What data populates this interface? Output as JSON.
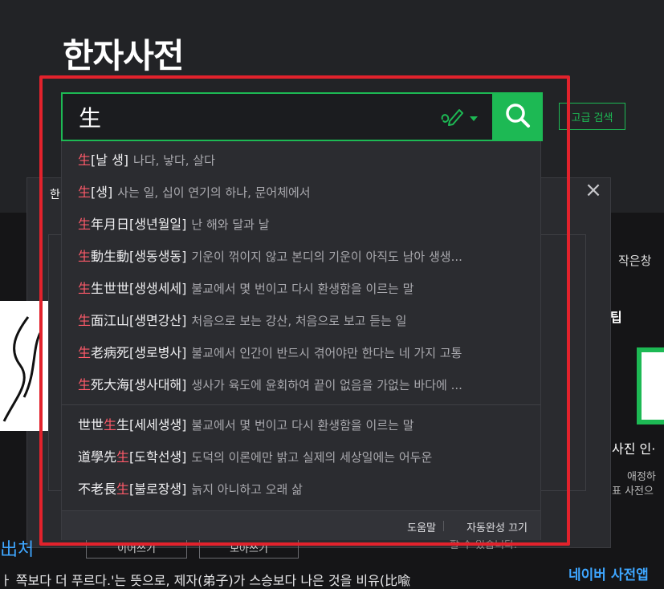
{
  "page": {
    "title": "한자사전"
  },
  "search": {
    "query": "生",
    "button_icon": "search-icon",
    "handwriting_icon": "handwriting-pen-icon",
    "advanced_label": "고급 검색"
  },
  "suggestions": {
    "group1": [
      {
        "pre": "",
        "hl": "生",
        "post": "",
        "reading": "[날 생]",
        "meaning": "나다, 낳다, 살다"
      },
      {
        "pre": "",
        "hl": "生",
        "post": "",
        "reading": "[생]",
        "meaning": "사는 일, 십이 연기의 하나, 문어체에서"
      },
      {
        "pre": "",
        "hl": "生",
        "post": "年月日",
        "reading": "[생년월일]",
        "meaning": "난 해와 달과 날"
      },
      {
        "pre": "",
        "hl": "生",
        "post": "動生動",
        "reading": "[생동생동]",
        "meaning": "기운이 꺾이지 않고 본디의 기운이 아직도 남아 생생..."
      },
      {
        "pre": "",
        "hl": "生",
        "post": "生世世",
        "reading": "[생생세세]",
        "meaning": "불교에서 몇 번이고 다시 환생함을 이르는 말"
      },
      {
        "pre": "",
        "hl": "生",
        "post": "面江山",
        "reading": "[생면강산]",
        "meaning": "처음으로 보는 강산, 처음으로 보고 듣는 일"
      },
      {
        "pre": "",
        "hl": "生",
        "post": "老病死",
        "reading": "[생로병사]",
        "meaning": "불교에서 인간이 반드시 겪어야만 한다는 네 가지 고통"
      },
      {
        "pre": "",
        "hl": "生",
        "post": "死大海",
        "reading": "[생사대해]",
        "meaning": "생사가 육도에 윤회하여 끝이 없음을 가없는 바다에 ..."
      }
    ],
    "group2": [
      {
        "pre": "世世",
        "hl": "生",
        "post": "生",
        "reading": "[세세생생]",
        "meaning": "불교에서 몇 번이고 다시 환생함을 이르는 말"
      },
      {
        "pre": "道學先",
        "hl": "生",
        "post": "",
        "reading": "[도학선생]",
        "meaning": "도덕의 이론에만 밝고 실제의 세상일에는 어두운"
      },
      {
        "pre": "不老長",
        "hl": "生",
        "post": "",
        "reading": "[불로장생]",
        "meaning": "늙지 아니하고 오래 삶"
      }
    ],
    "footer": {
      "help": "도움말",
      "autocomplete_off": "자동완성 끄기"
    }
  },
  "background": {
    "panel_title": "한",
    "small_window": "작은창",
    "tip": "팁",
    "photo_info": "사진 인·",
    "favorite": "애정하",
    "representative": "표 사전으",
    "chars": "出처",
    "btn1": "이어쓰기",
    "btn2": "모아쓰기",
    "notice": "할 수 있습니다.",
    "bottom_text": "ㅏ 쪽보다 더 푸르다.'는 뜻으로, 제자(弟子)가 스승보다 나은 것을 비유(比喩",
    "naver_app": "네이버 사전앱"
  },
  "colors": {
    "accent": "#1db954",
    "highlight": "#ff5a6a",
    "annotation": "#e2222c"
  }
}
